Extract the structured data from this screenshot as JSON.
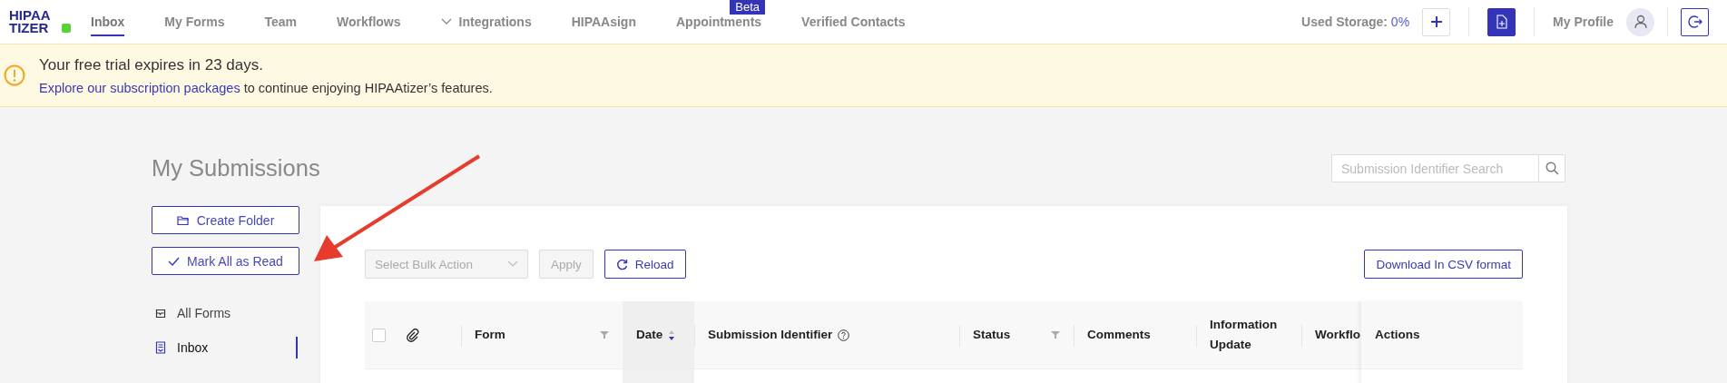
{
  "logo": {
    "line1": "HIPAA",
    "line2": "TIZER"
  },
  "nav": [
    {
      "label": "Inbox",
      "selected": true,
      "dropdown": false
    },
    {
      "label": "My Forms",
      "selected": false,
      "dropdown": false
    },
    {
      "label": "Team",
      "selected": false,
      "dropdown": false
    },
    {
      "label": "Workflows",
      "selected": false,
      "dropdown": false
    },
    {
      "label": "Integrations",
      "selected": false,
      "dropdown": true
    },
    {
      "label": "HIPAAsign",
      "selected": false,
      "dropdown": false
    },
    {
      "label": "Appointments",
      "selected": false,
      "dropdown": false,
      "badge": "Beta"
    },
    {
      "label": "Verified Contacts",
      "selected": false,
      "dropdown": false
    }
  ],
  "storage": {
    "label": "Used Storage:",
    "value": "0%"
  },
  "profile": {
    "label": "My Profile"
  },
  "banner": {
    "title": "Your free trial expires in 23 days.",
    "link": "Explore our subscription packages",
    "text": " to continue enjoying HIPAAtizer’s features."
  },
  "page_title": "My Submissions",
  "search": {
    "placeholder": "Submission Identifier Search"
  },
  "sidebar": {
    "buttons": [
      {
        "label": "Create Folder",
        "kind": "folder"
      },
      {
        "label": "Mark All as Read",
        "kind": "check"
      }
    ],
    "items": [
      {
        "label": "All Forms",
        "kind": "tray",
        "selected": false
      },
      {
        "label": "Inbox",
        "kind": "inbox",
        "selected": true
      }
    ]
  },
  "toolbar": {
    "bulk_action": {
      "placeholder": "Select Bulk Action",
      "disabled": true
    },
    "apply": {
      "label": "Apply",
      "disabled": true
    },
    "reload": {
      "label": "Reload"
    },
    "download": {
      "label": "Download In CSV format"
    }
  },
  "table": {
    "columns": [
      {
        "kind": "checkbox",
        "checked": false
      },
      {
        "kind": "attachment"
      },
      {
        "kind": "filter",
        "label": "Form"
      },
      {
        "kind": "sort",
        "label": "Date"
      },
      {
        "kind": "help",
        "label": "Submission Identifier"
      },
      {
        "kind": "filter",
        "label": "Status"
      },
      {
        "kind": "plain",
        "label": "Comments"
      },
      {
        "kind": "plain",
        "label": "Information Update"
      },
      {
        "kind": "plain",
        "label": "Workflo"
      },
      {
        "kind": "plain",
        "label": "Actions"
      }
    ]
  }
}
